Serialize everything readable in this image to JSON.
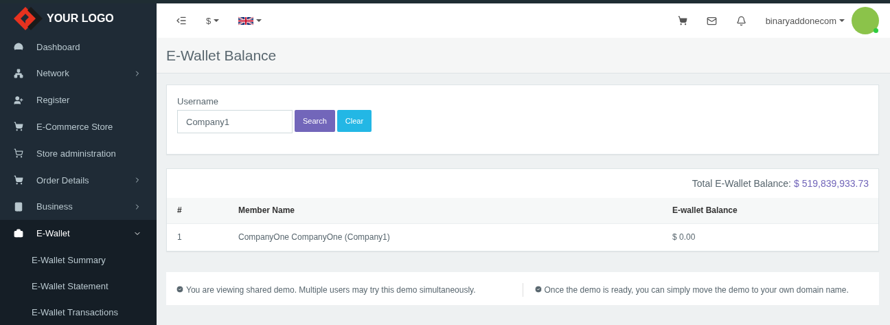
{
  "logo": {
    "text": "YOUR LOGO"
  },
  "sidebar": {
    "items": [
      {
        "label": "Dashboard",
        "selected": false
      },
      {
        "label": "Network",
        "expanded": false,
        "selected": false
      },
      {
        "label": "Register",
        "selected": false
      },
      {
        "label": "E-Commerce Store",
        "selected": false
      },
      {
        "label": "Store administration",
        "selected": false
      },
      {
        "label": "Order Details",
        "expanded": false,
        "selected": false
      },
      {
        "label": "Business",
        "expanded": false,
        "selected": false
      },
      {
        "label": "E-Wallet",
        "expanded": true,
        "selected": true,
        "children": [
          {
            "label": "E-Wallet Summary"
          },
          {
            "label": "E-Wallet Statement"
          },
          {
            "label": "E-Wallet Transactions"
          }
        ]
      }
    ]
  },
  "topbar": {
    "currency": "$",
    "user": "binaryaddonecom",
    "online": true
  },
  "page_title": "E-Wallet Balance",
  "search_form": {
    "label": "Username",
    "value": "Company1",
    "buttons": [
      {
        "label": "Search",
        "kind": "primary"
      },
      {
        "label": "Clear",
        "kind": "info"
      }
    ]
  },
  "balance": {
    "label": "Total E-Wallet Balance:",
    "amount": "$ 519,839,933.73"
  },
  "table": {
    "columns": [
      "#",
      "Member Name",
      "E-wallet Balance"
    ],
    "rows": [
      [
        "1",
        "CompanyOne CompanyOne (Company1)",
        "$ 0.00"
      ]
    ]
  },
  "notices": [
    "You are viewing shared demo. Multiple users may try this demo simultaneously.",
    "Once the demo is ready, you can simply move the demo to your own domain name."
  ]
}
